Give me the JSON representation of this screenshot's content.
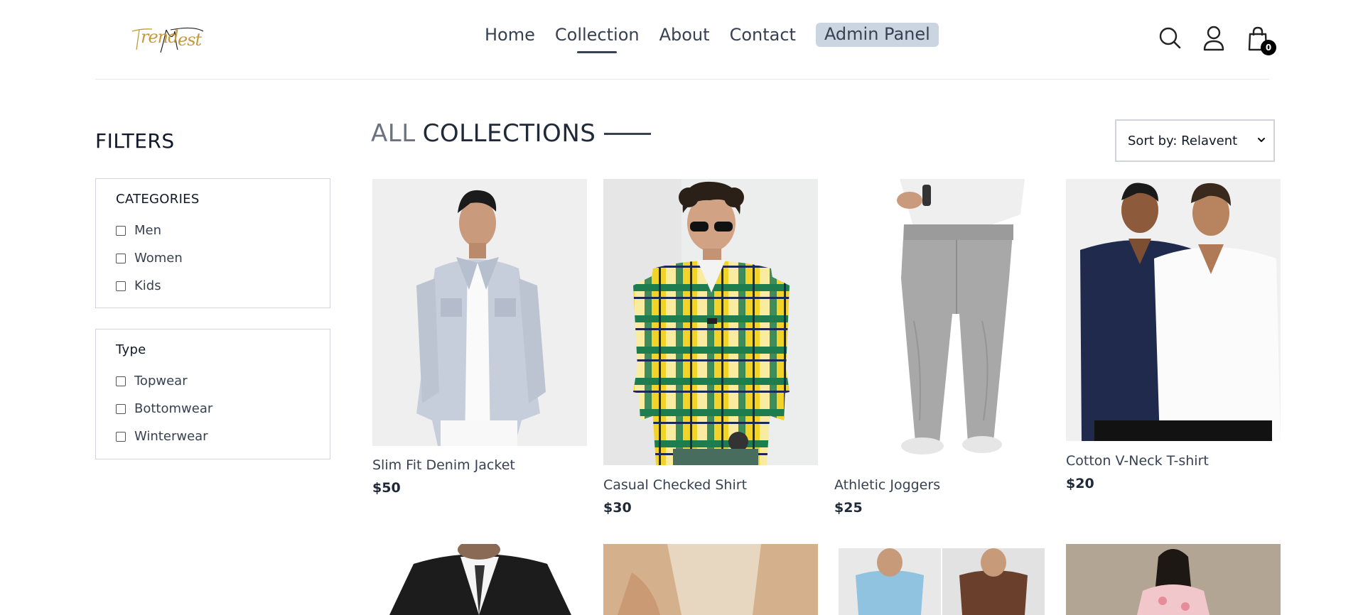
{
  "header": {
    "logo_text": "TrendNest",
    "nav": [
      {
        "label": "Home"
      },
      {
        "label": "Collection"
      },
      {
        "label": "About"
      },
      {
        "label": "Contact"
      }
    ],
    "admin_label": "Admin Panel",
    "cart_count": "0",
    "icons": [
      "search-icon",
      "user-icon",
      "shopping-bag-icon"
    ]
  },
  "filters": {
    "title": "FILTERS",
    "categories": {
      "heading": "CATEGORIES",
      "options": [
        "Men",
        "Women",
        "Kids"
      ]
    },
    "type": {
      "heading": "Type",
      "options": [
        "Topwear",
        "Bottomwear",
        "Winterwear"
      ]
    }
  },
  "collections": {
    "title_a": "ALL",
    "title_b": "COLLECTIONS",
    "sort_label": "Sort by: Relavent"
  },
  "products": [
    {
      "name": "Slim Fit Denim Jacket",
      "price": "$50"
    },
    {
      "name": "Casual Checked Shirt",
      "price": "$30"
    },
    {
      "name": "Athletic Joggers",
      "price": "$25"
    },
    {
      "name": "Cotton V-Neck T-shirt",
      "price": "$20"
    }
  ],
  "colors": {
    "accent": "#374151",
    "admin_bg": "#cbd5e1",
    "logo": "#c59a3d",
    "border": "#d1d5db"
  }
}
